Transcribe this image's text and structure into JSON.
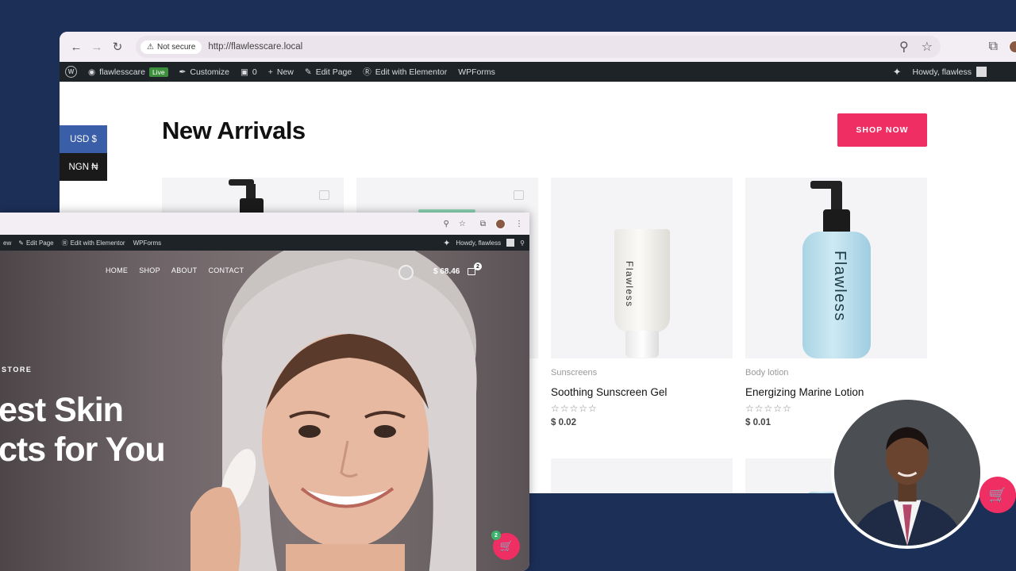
{
  "back_window": {
    "security_label": "Not secure",
    "url": "http://flawlesscare.local",
    "admin_bar": {
      "site_name": "flawlesscare",
      "live_badge": "Live",
      "customize": "Customize",
      "comments_count": "0",
      "new": "New",
      "edit_page": "Edit Page",
      "edit_elementor": "Edit with Elementor",
      "wpforms": "WPForms",
      "howdy": "Howdy, flawless"
    },
    "section_title": "New Arrivals",
    "shop_button": "SHOP NOW",
    "currency": {
      "usd": "USD $",
      "ngn": "NGN ₦"
    },
    "products": [
      {
        "category": "Sunscreens",
        "name": "Soothing Sunscreen Gel",
        "rating": 0,
        "price": "$ 0.02",
        "product_label": "Flawless"
      },
      {
        "category": "Body lotion",
        "name": "Energizing Marine Lotion",
        "rating": 0,
        "price": "$ 0.01",
        "product_label": "Flawless"
      }
    ]
  },
  "front_window": {
    "admin_bar": {
      "new_partial": "ew",
      "edit_page": "Edit Page",
      "edit_elementor": "Edit with Elementor",
      "wpforms": "WPForms",
      "howdy": "Howdy, flawless"
    },
    "nav": [
      "HOME",
      "SHOP",
      "ABOUT",
      "CONTACT"
    ],
    "cart_total": "$ 68.46",
    "cart_count": "2",
    "tagline": "STORE",
    "hero_line1": "est Skin",
    "hero_line2": "cts for You",
    "fab_count": "2"
  },
  "colors": {
    "accent": "#ef2e63",
    "navy": "#1c2f57",
    "adminbar": "#1d2327",
    "usd": "#3a5ea8"
  },
  "icons": [
    "back-arrow-icon",
    "forward-arrow-icon",
    "reload-icon",
    "warning-icon",
    "location-icon",
    "star-icon",
    "extensions-icon",
    "wordpress-icon",
    "dashboard-icon",
    "brush-icon",
    "comment-icon",
    "plus-icon",
    "pencil-icon",
    "elementor-icon",
    "sparkle-icon",
    "search-icon",
    "cart-icon",
    "bag-icon",
    "user-icon"
  ]
}
